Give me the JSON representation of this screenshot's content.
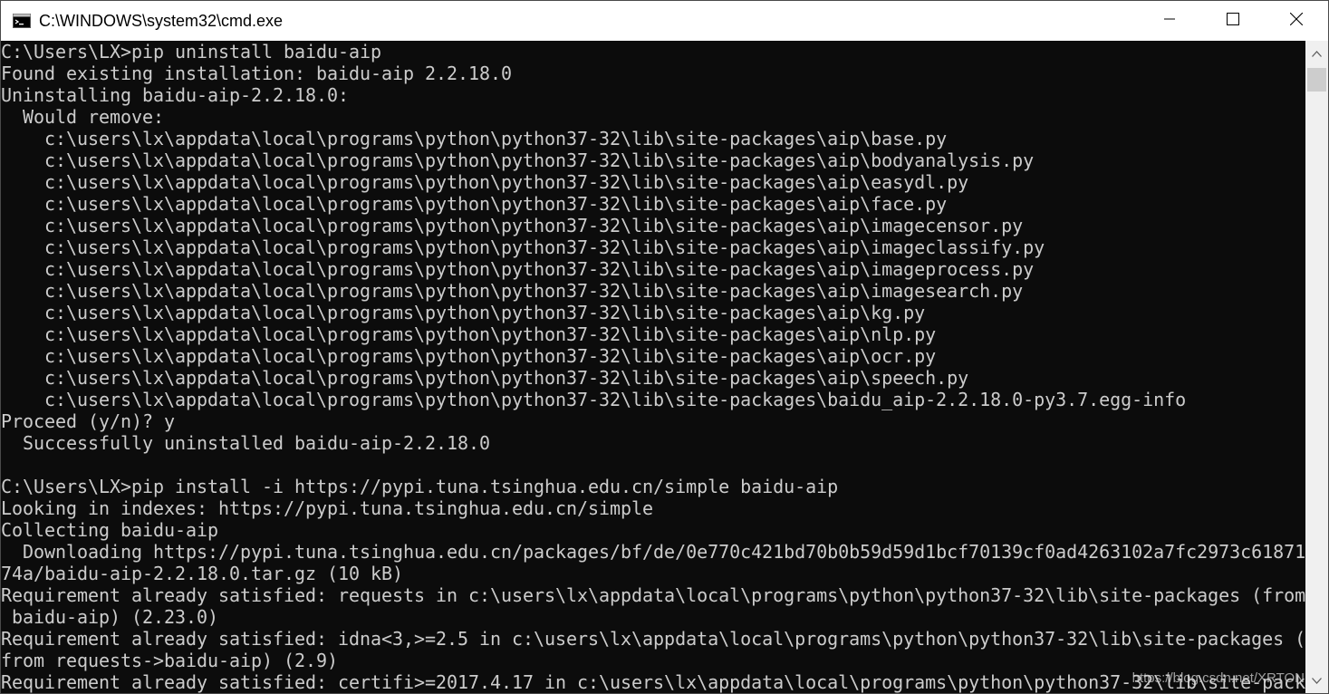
{
  "window": {
    "title": "C:\\WINDOWS\\system32\\cmd.exe",
    "app_icon": "cmd-console-icon",
    "controls": {
      "minimize_icon": "minimize-icon",
      "maximize_icon": "maximize-icon",
      "close_icon": "close-icon"
    }
  },
  "console": {
    "background": "#0c0c0c",
    "foreground": "#cccccc",
    "lines": [
      "C:\\Users\\LX>pip uninstall baidu-aip",
      "Found existing installation: baidu-aip 2.2.18.0",
      "Uninstalling baidu-aip-2.2.18.0:",
      "  Would remove:",
      "    c:\\users\\lx\\appdata\\local\\programs\\python\\python37-32\\lib\\site-packages\\aip\\base.py",
      "    c:\\users\\lx\\appdata\\local\\programs\\python\\python37-32\\lib\\site-packages\\aip\\bodyanalysis.py",
      "    c:\\users\\lx\\appdata\\local\\programs\\python\\python37-32\\lib\\site-packages\\aip\\easydl.py",
      "    c:\\users\\lx\\appdata\\local\\programs\\python\\python37-32\\lib\\site-packages\\aip\\face.py",
      "    c:\\users\\lx\\appdata\\local\\programs\\python\\python37-32\\lib\\site-packages\\aip\\imagecensor.py",
      "    c:\\users\\lx\\appdata\\local\\programs\\python\\python37-32\\lib\\site-packages\\aip\\imageclassify.py",
      "    c:\\users\\lx\\appdata\\local\\programs\\python\\python37-32\\lib\\site-packages\\aip\\imageprocess.py",
      "    c:\\users\\lx\\appdata\\local\\programs\\python\\python37-32\\lib\\site-packages\\aip\\imagesearch.py",
      "    c:\\users\\lx\\appdata\\local\\programs\\python\\python37-32\\lib\\site-packages\\aip\\kg.py",
      "    c:\\users\\lx\\appdata\\local\\programs\\python\\python37-32\\lib\\site-packages\\aip\\nlp.py",
      "    c:\\users\\lx\\appdata\\local\\programs\\python\\python37-32\\lib\\site-packages\\aip\\ocr.py",
      "    c:\\users\\lx\\appdata\\local\\programs\\python\\python37-32\\lib\\site-packages\\aip\\speech.py",
      "    c:\\users\\lx\\appdata\\local\\programs\\python\\python37-32\\lib\\site-packages\\baidu_aip-2.2.18.0-py3.7.egg-info",
      "Proceed (y/n)? y",
      "  Successfully uninstalled baidu-aip-2.2.18.0",
      "",
      "C:\\Users\\LX>pip install -i https://pypi.tuna.tsinghua.edu.cn/simple baidu-aip",
      "Looking in indexes: https://pypi.tuna.tsinghua.edu.cn/simple",
      "Collecting baidu-aip",
      "  Downloading https://pypi.tuna.tsinghua.edu.cn/packages/bf/de/0e770c421bd70b0b59d59d1bcf70139cf0ad4263102a7fc2973c61871",
      "74a/baidu-aip-2.2.18.0.tar.gz (10 kB)",
      "Requirement already satisfied: requests in c:\\users\\lx\\appdata\\local\\programs\\python\\python37-32\\lib\\site-packages (from",
      " baidu-aip) (2.23.0)",
      "Requirement already satisfied: idna<3,>=2.5 in c:\\users\\lx\\appdata\\local\\programs\\python\\python37-32\\lib\\site-packages (",
      "from requests->baidu-aip) (2.9)",
      "Requirement already satisfied: certifi>=2017.4.17 in c:\\users\\lx\\appdata\\local\\programs\\python\\python37-32\\lib\\site-pack"
    ]
  },
  "watermark": "https://blog.csdn.net/XRTON"
}
